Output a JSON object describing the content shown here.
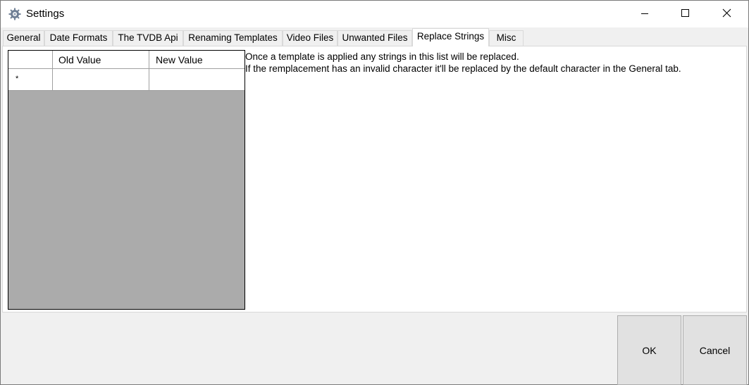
{
  "window": {
    "title": "Settings",
    "controls": [
      "minimize",
      "maximize",
      "close"
    ]
  },
  "tabs": [
    {
      "label": "General",
      "active": false
    },
    {
      "label": "Date Formats",
      "active": false
    },
    {
      "label": "The TVDB Api",
      "active": false
    },
    {
      "label": "Renaming Templates",
      "active": false
    },
    {
      "label": "Video Files",
      "active": false
    },
    {
      "label": "Unwanted Files",
      "active": false
    },
    {
      "label": "Replace Strings",
      "active": true
    },
    {
      "label": "Misc",
      "active": false
    }
  ],
  "grid": {
    "columns": [
      "Old Value",
      "New Value"
    ],
    "new_row_marker": "*",
    "rows": []
  },
  "info": {
    "line1": "Once a template is applied any strings in this list will be replaced.",
    "line2": "If the remplacement has an invalid character it'll be replaced by the default character in the General tab."
  },
  "buttons": {
    "ok": "OK",
    "cancel": "Cancel"
  },
  "icons": {
    "app": "gear-icon",
    "minimize": "minimize-icon",
    "maximize": "maximize-icon",
    "close": "close-icon"
  }
}
